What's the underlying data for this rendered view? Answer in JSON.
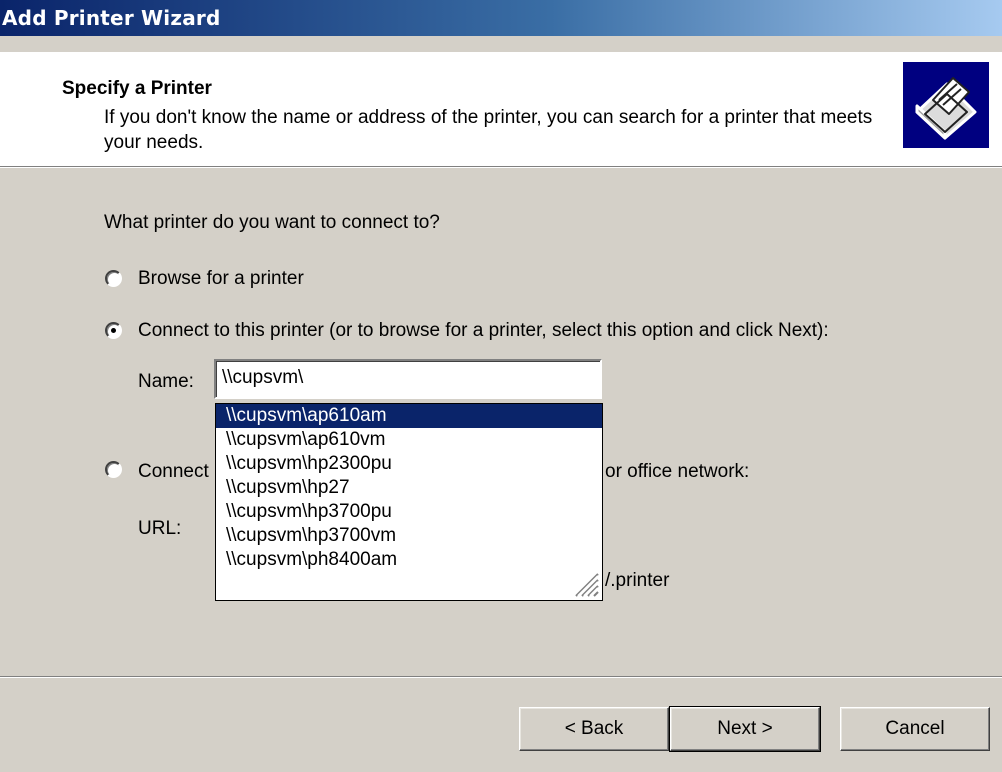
{
  "window": {
    "title": "Add Printer Wizard"
  },
  "header": {
    "title": "Specify a Printer",
    "subtitle": "If you don't know the name or address of the printer, you can search for a printer that meets your needs.",
    "icon": "printer-icon"
  },
  "question": "What printer do you want to connect to?",
  "options": {
    "browse": {
      "label": "Browse for a printer",
      "checked": false
    },
    "connect": {
      "label": "Connect to this printer (or to browse for a printer, select this option and click Next):",
      "checked": true
    },
    "internet_prefix": "Connect",
    "internet_suffix": "or office network:"
  },
  "name_field": {
    "label": "Name:",
    "value": "\\\\cupsvm\\"
  },
  "url_field": {
    "label": "URL:",
    "example_suffix": "/.printer"
  },
  "autocomplete": {
    "items": [
      "\\\\cupsvm\\ap610am",
      "\\\\cupsvm\\ap610vm",
      "\\\\cupsvm\\hp2300pu",
      "\\\\cupsvm\\hp27",
      "\\\\cupsvm\\hp3700pu",
      "\\\\cupsvm\\hp3700vm",
      "\\\\cupsvm\\ph8400am"
    ],
    "selected_index": 0
  },
  "buttons": {
    "back": "< Back",
    "next": "Next >",
    "cancel": "Cancel"
  }
}
